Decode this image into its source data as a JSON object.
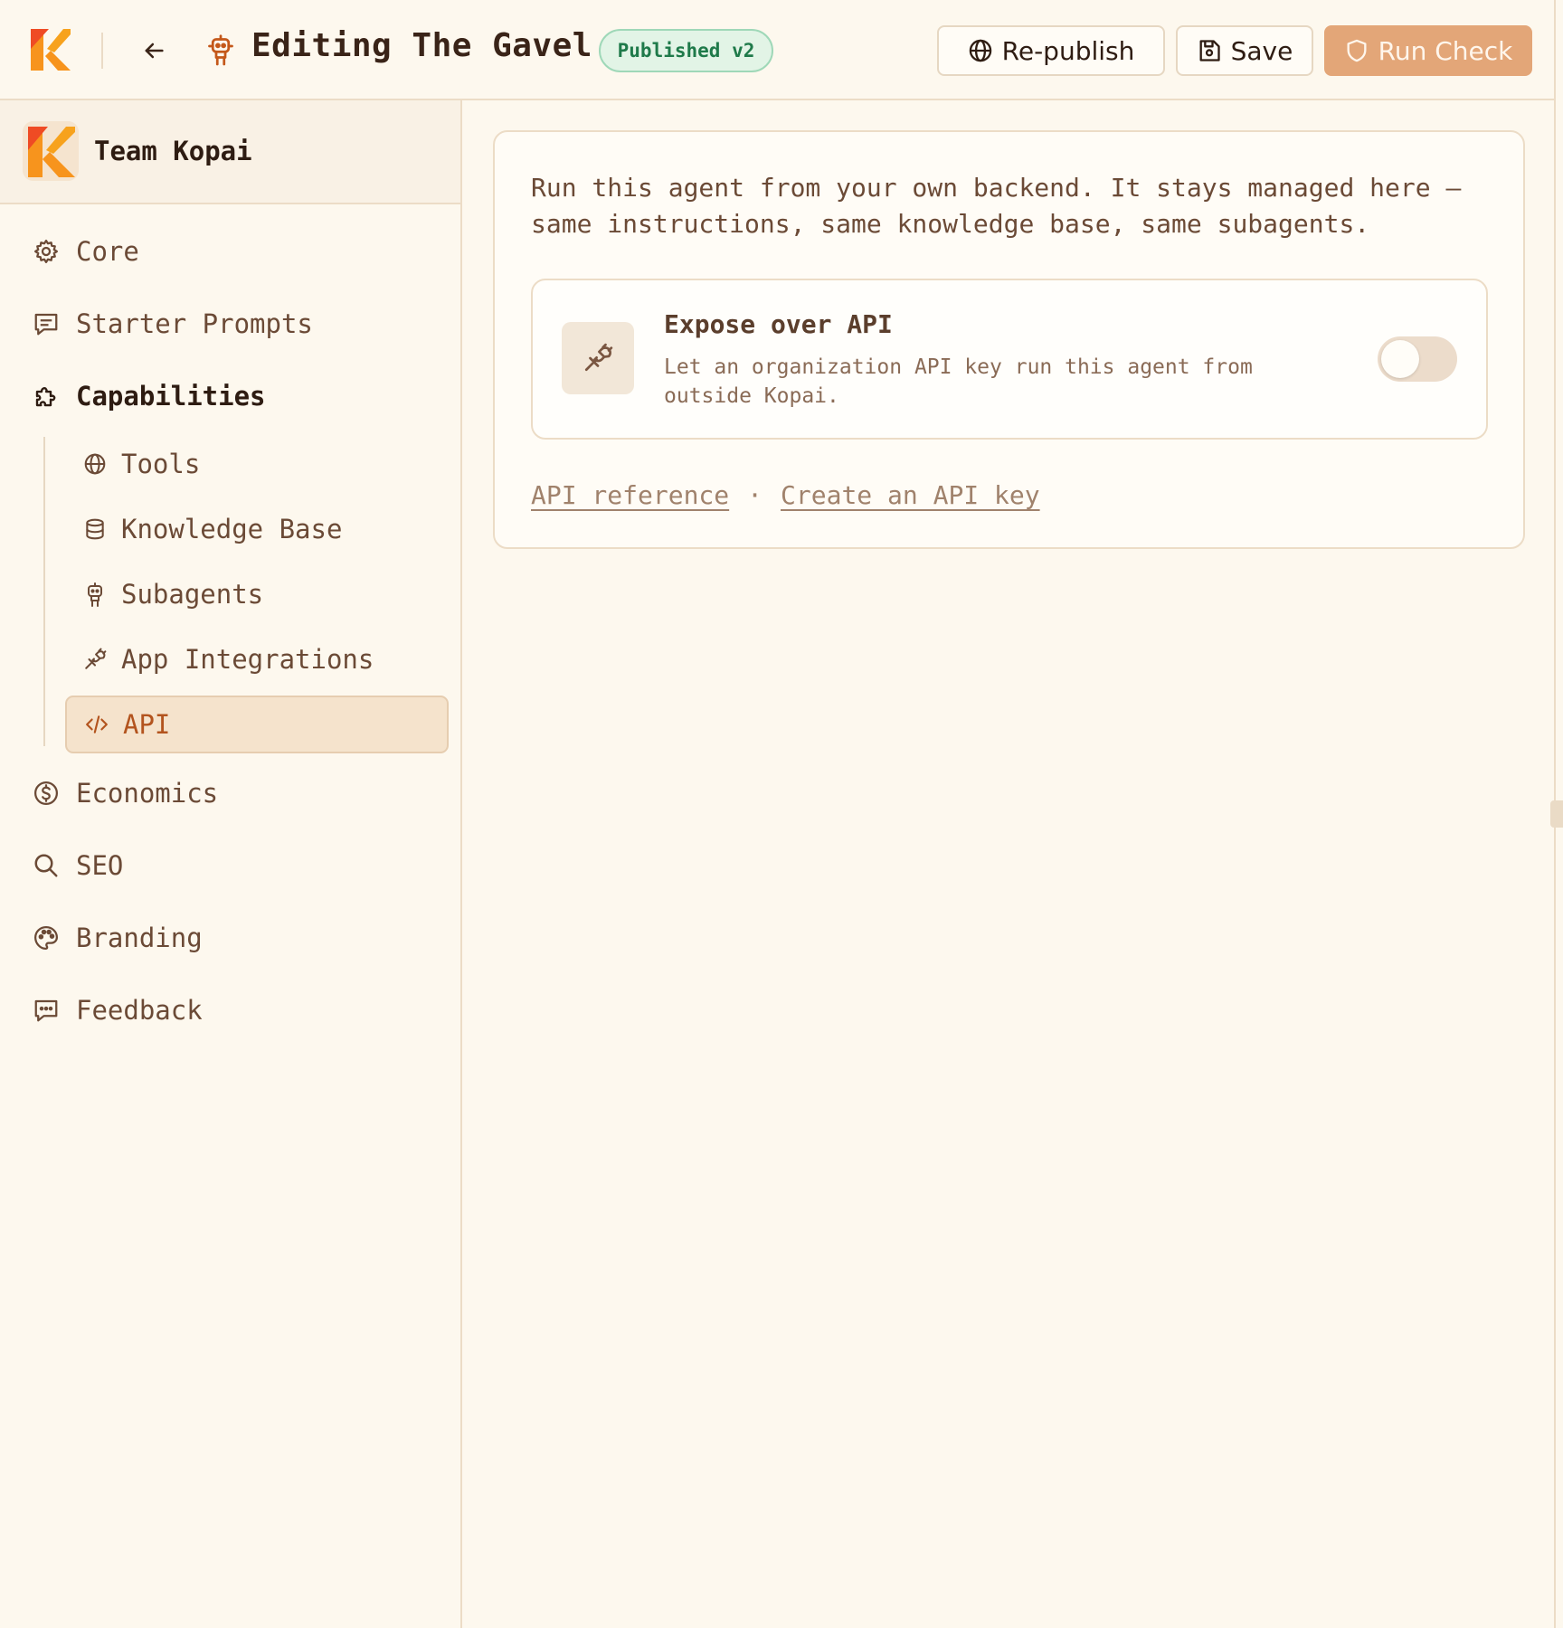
{
  "header": {
    "title": "Editing The Gavel",
    "badge": "Published v2",
    "republish_label": "Re-publish",
    "save_label": "Save",
    "run_check_label": "Run Check"
  },
  "sidebar": {
    "team_name": "Team Kopai",
    "items": [
      {
        "label": "Core",
        "icon": "gear-icon"
      },
      {
        "label": "Starter Prompts",
        "icon": "message-icon"
      },
      {
        "label": "Capabilities",
        "icon": "puzzle-icon"
      },
      {
        "label": "Economics",
        "icon": "dollar-icon"
      },
      {
        "label": "SEO",
        "icon": "search-icon"
      },
      {
        "label": "Branding",
        "icon": "palette-icon"
      },
      {
        "label": "Feedback",
        "icon": "chat-icon"
      }
    ],
    "sub_items": [
      {
        "label": "Tools",
        "icon": "globe-icon"
      },
      {
        "label": "Knowledge Base",
        "icon": "database-icon"
      },
      {
        "label": "Subagents",
        "icon": "robot-icon"
      },
      {
        "label": "App Integrations",
        "icon": "plug-icon"
      },
      {
        "label": "API",
        "icon": "code-icon",
        "active": true
      }
    ]
  },
  "main": {
    "intro": "Run this agent from your own backend. It stays managed here — same instructions, same knowledge base, same subagents.",
    "expose": {
      "title": "Expose over API",
      "description": "Let an organization API key run this agent from outside Kopai.",
      "enabled": false
    },
    "links": {
      "api_reference": "API reference",
      "separator": "·",
      "create_key": "Create an API key"
    }
  },
  "colors": {
    "background": "#fdf8ee",
    "accent": "#b3541e",
    "primary_button": "#e3a678",
    "badge_green": "#1f7a4a"
  }
}
